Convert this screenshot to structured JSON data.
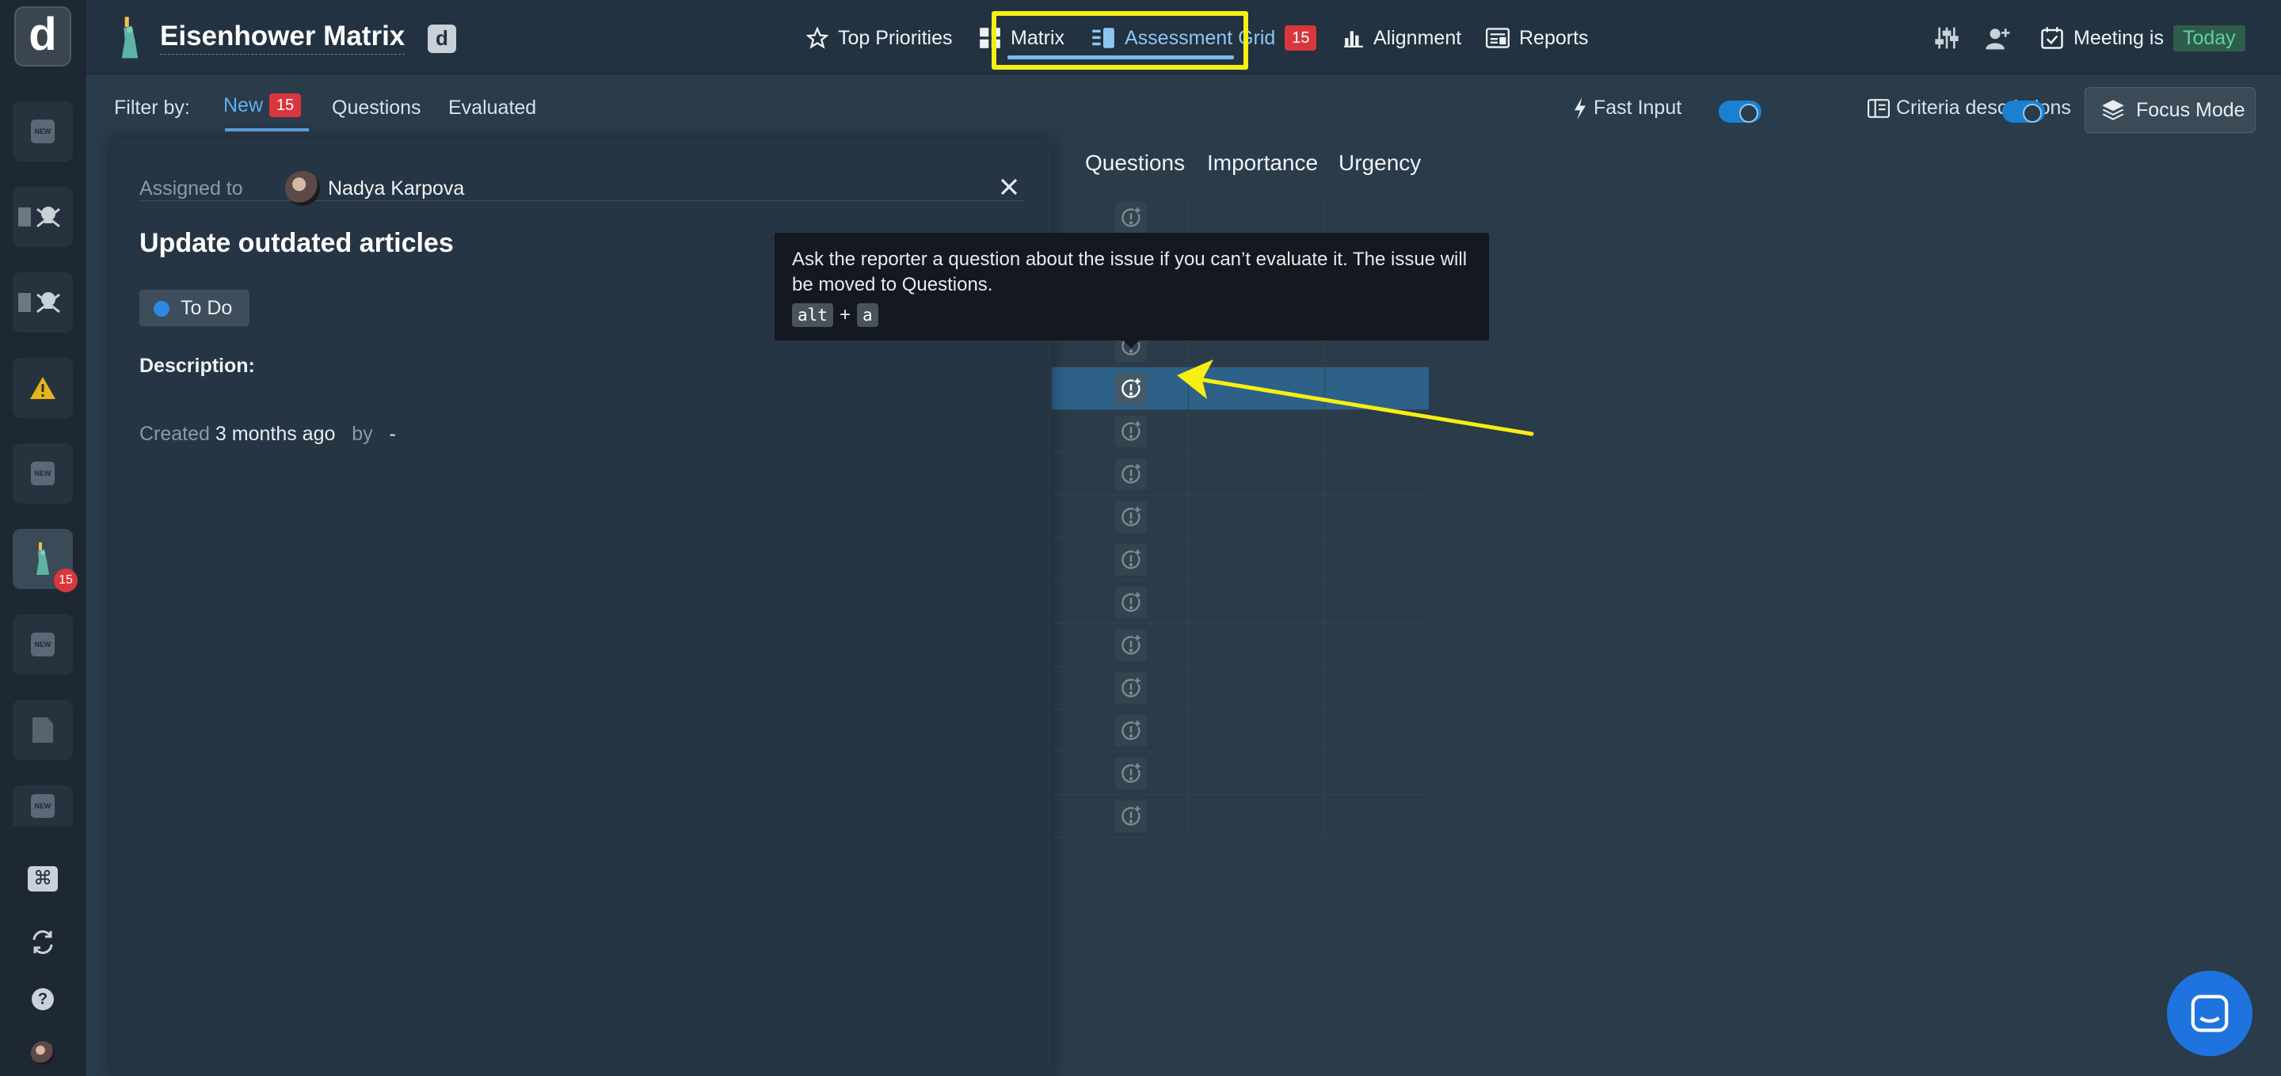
{
  "app": {
    "title": "Eisenhower Matrix",
    "project_letter": "d",
    "logo_letter": "d"
  },
  "rail": {
    "new_label": "NEW",
    "active_badge": "15"
  },
  "nav": {
    "top_priorities": "Top Priorities",
    "matrix": "Matrix",
    "assessment_grid": "Assessment Grid",
    "assessment_count": "15",
    "alignment": "Alignment",
    "reports": "Reports"
  },
  "meeting": {
    "label": "Meeting is",
    "value": "Today"
  },
  "filter": {
    "label": "Filter by:",
    "new": "New",
    "new_count": "15",
    "questions": "Questions",
    "evaluated": "Evaluated"
  },
  "options": {
    "fast_input": "Fast Input",
    "criteria_descriptions": "Criteria descriptions",
    "focus_mode": "Focus Mode"
  },
  "issue": {
    "assigned_label": "Assigned to",
    "assignee": "Nadya Karpova",
    "title": "Update outdated articles",
    "status": "To Do",
    "description_label": "Description:",
    "created_label": "Created",
    "created_value": "3 months ago",
    "by_label": "by",
    "by_value": "-"
  },
  "grid": {
    "columns": [
      "Questions",
      "Importance",
      "Urgency"
    ],
    "row_count": 15,
    "selected_row": 4
  },
  "tooltip": {
    "text": "Ask the reporter a question about the issue if you can’t evaluate it. The issue will be moved to Questions.",
    "key1": "alt",
    "plus": "+",
    "key2": "a"
  },
  "colors": {
    "highlight": "#f7ef12",
    "accent": "#1a81d2",
    "badge": "#d9363e",
    "today": "#5fd39b"
  }
}
